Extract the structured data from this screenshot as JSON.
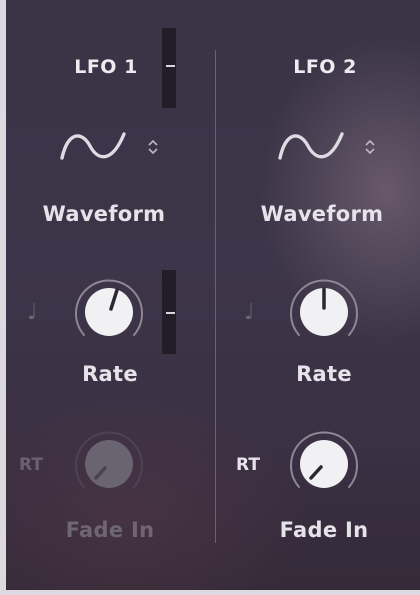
{
  "lfo1": {
    "title": "LFO 1",
    "waveform_label": "Waveform",
    "rate_label": "Rate",
    "fade_in_label": "Fade In",
    "fade_in_mode": "RT",
    "note_symbol": "♩",
    "fade_in_enabled": false
  },
  "lfo2": {
    "title": "LFO 2",
    "waveform_label": "Waveform",
    "rate_label": "Rate",
    "fade_in_label": "Fade In",
    "fade_in_mode": "RT",
    "note_symbol": "♩",
    "fade_in_enabled": true
  },
  "colors": {
    "knob_face": "#f1f0f3",
    "knob_ring": "#8e8794",
    "knob_pointer": "#2b2630",
    "disabled_knob": "#6a6370",
    "background": "#3b3446"
  },
  "icons": {
    "waveform": "sine-wave-icon",
    "selector": "up-down-chevron-icon",
    "sync": "quarter-note-icon"
  }
}
